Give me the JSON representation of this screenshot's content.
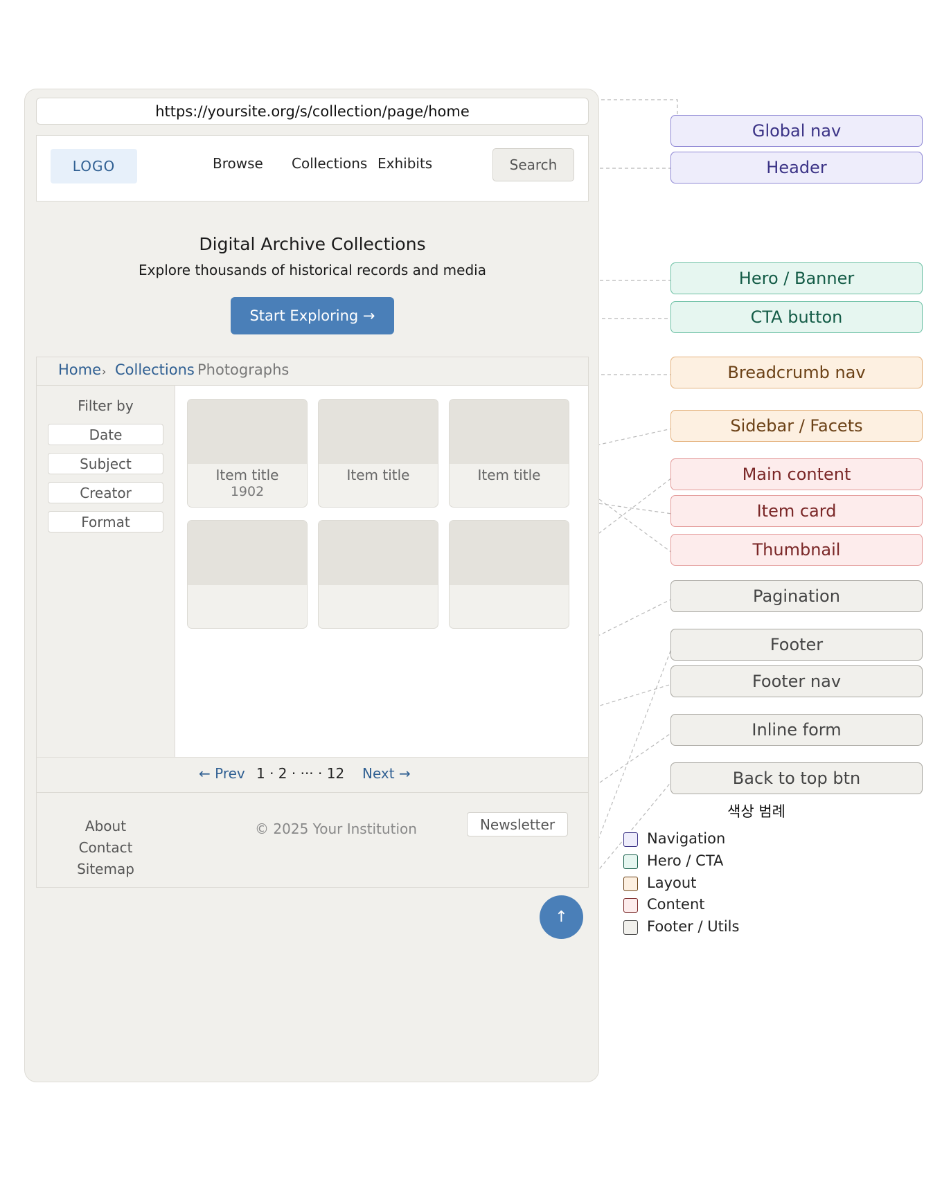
{
  "wireframe": {
    "url": "https://yoursite.org/s/collection/page/home",
    "logo": "LOGO",
    "nav": [
      "Browse",
      "Collections",
      "Exhibits"
    ],
    "search_label": "Search",
    "hero": {
      "title": "Digital Archive Collections",
      "subtitle": "Explore thousands of historical records and media",
      "cta": "Start Exploring →"
    },
    "breadcrumb": {
      "home": "Home",
      "sep": "›",
      "collections": "Collections",
      "current": "Photographs"
    },
    "sidebar": {
      "title": "Filter by",
      "facets": [
        "Date",
        "Subject",
        "Creator",
        "Format"
      ]
    },
    "cards": [
      {
        "title": "Item title",
        "year": "1902"
      },
      {
        "title": "Item title",
        "year": ""
      },
      {
        "title": "Item title",
        "year": ""
      },
      {
        "title": "",
        "year": ""
      },
      {
        "title": "",
        "year": ""
      },
      {
        "title": "",
        "year": ""
      }
    ],
    "pagination": {
      "prev": "← Prev",
      "pages": "1 · 2 · ··· · 12",
      "next": "Next →"
    },
    "footer": {
      "nav": [
        "About",
        "Contact",
        "Sitemap"
      ],
      "copyright": "© 2025 Your Institution",
      "newsletter": "Newsletter"
    },
    "back_to_top": "↑"
  },
  "labels": {
    "global_nav": "Global nav",
    "header": "Header",
    "hero": "Hero / Banner",
    "cta": "CTA button",
    "breadcrumb": "Breadcrumb nav",
    "sidebar": "Sidebar / Facets",
    "main": "Main content",
    "item_card": "Item card",
    "thumbnail": "Thumbnail",
    "pagination": "Pagination",
    "footer": "Footer",
    "footer_nav": "Footer nav",
    "inline_form": "Inline form",
    "back_to_top": "Back to top btn"
  },
  "legend": {
    "title": "색상 범례",
    "items": [
      "Navigation",
      "Hero / CTA",
      "Layout",
      "Content",
      "Footer / Utils"
    ]
  },
  "colors": {
    "navigation": "#8e87d4",
    "hero_cta": "#6cc0a4",
    "layout": "#e4b17c",
    "content": "#e39a99",
    "footer_utils": "#a9a7a1",
    "accent_blue": "#4a7fb8"
  }
}
